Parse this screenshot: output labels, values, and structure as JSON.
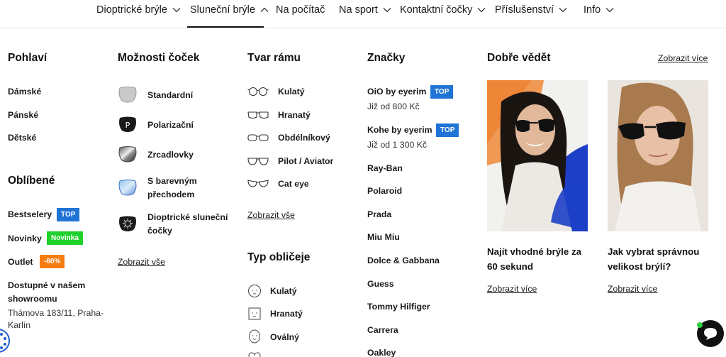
{
  "nav": [
    {
      "label": "Dioptrické brýle"
    },
    {
      "label": "Sluneční brýle"
    },
    {
      "label": "Na počítač"
    },
    {
      "label": "Na sport"
    },
    {
      "label": "Kontaktní čočky"
    },
    {
      "label": "Příslušenství"
    },
    {
      "label": "Info"
    }
  ],
  "gender": {
    "title": "Pohlaví",
    "items": [
      "Dámské",
      "Pánské",
      "Dětské"
    ]
  },
  "popular": {
    "title": "Oblíbené",
    "bestsellers": "Bestselery",
    "bestsellers_badge": "TOP",
    "news": "Novinky",
    "news_badge": "Novinka",
    "outlet": "Outlet",
    "outlet_badge": "-60%",
    "showroom_line1": "Dostupné v našem",
    "showroom_line2": "showroomu",
    "address_line1": "Thámova 183/11, Praha-",
    "address_line2": "Karlín"
  },
  "lens_options": {
    "title": "Možnosti čoček",
    "items": [
      {
        "label": "Standardní",
        "icon": "standard-lens-icon"
      },
      {
        "label": "Polarizační",
        "icon": "polarized-lens-icon"
      },
      {
        "label": "Zrcadlovky",
        "icon": "mirror-lens-icon"
      },
      {
        "label_line1": "S barevným",
        "label_line2": "přechodem",
        "icon": "gradient-lens-icon"
      },
      {
        "label_line1": "Dioptrické sluneční",
        "label_line2": "čočky",
        "icon": "prescription-lens-icon"
      }
    ],
    "show_all": "Zobrazit vše"
  },
  "frame_shape": {
    "title": "Tvar rámu",
    "items": [
      "Kulatý",
      "Hranatý",
      "Obdélníkový",
      "Pilot / Aviator",
      "Cat eye"
    ],
    "show_all": "Zobrazit vše"
  },
  "face_type": {
    "title": "Typ obličeje",
    "items": [
      "Kulatý",
      "Hranatý",
      "Oválný"
    ]
  },
  "brands": {
    "title": "Značky",
    "featured": [
      {
        "name": "OiO by eyerim",
        "badge": "TOP",
        "price": "Již od 800 Kč"
      },
      {
        "name": "Kohe by eyerim",
        "badge": "TOP",
        "price": "Již od 1 300 Kč"
      }
    ],
    "items": [
      "Ray-Ban",
      "Polaroid",
      "Prada",
      "Miu Miu",
      "Dolce & Gabbana",
      "Guess",
      "Tommy Hilfiger",
      "Carrera",
      "Oakley"
    ]
  },
  "good_to_know": {
    "title": "Dobře vědět",
    "show_more": "Zobrazit více",
    "cards": [
      {
        "title_line1": "Najít vhodné brýle za",
        "title_line2": "60 sekund",
        "link": "Zobrazit více"
      },
      {
        "title_line1": "Jak vybrat správnou",
        "title_line2": "velikost brýlí?",
        "link": "Zobrazit více"
      }
    ]
  },
  "colors": {
    "badge_blue": "#1f74d6",
    "badge_green": "#1fd12a",
    "badge_orange": "#f77d12"
  }
}
